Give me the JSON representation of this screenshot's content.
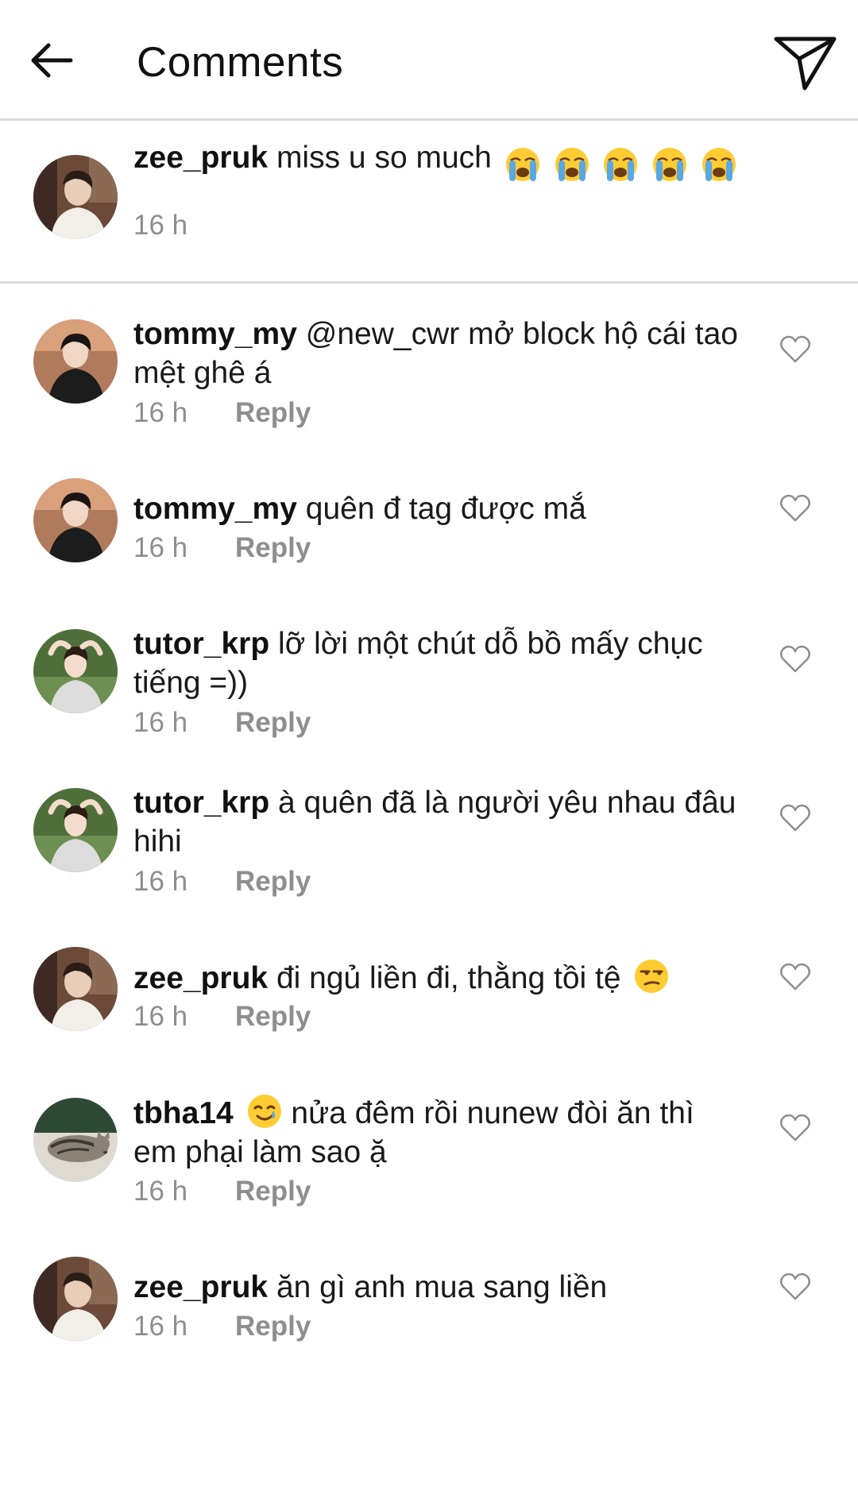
{
  "header": {
    "title": "Comments"
  },
  "caption": {
    "username": "zee_pruk",
    "text": "miss u so much",
    "emoji_count": 5,
    "emoji": "loudly-crying-face",
    "time": "16 h"
  },
  "reply_label": "Reply",
  "comments": [
    {
      "username": "tommy_my",
      "text": "@new_cwr mở block hộ cái tao mệt ghê á",
      "time": "16 h"
    },
    {
      "username": "tommy_my",
      "text": "quên đ tag được mắ",
      "time": "16 h"
    },
    {
      "username": "tutor_krp",
      "text": "lỡ lời một chút dỗ bồ mấy chục tiếng =))",
      "time": "16 h"
    },
    {
      "username": "tutor_krp",
      "text": "à quên đã là người yêu nhau đâu hihi",
      "time": "16 h"
    },
    {
      "username": "zee_pruk",
      "text": "đi ngủ liền đi, thằng tồi tệ",
      "emoji_after": "unamused-face",
      "time": "16 h"
    },
    {
      "username": "tbha14",
      "emoji_before": "smiling-face-with-tear",
      "text": "nửa đêm rồi nunew đòi ăn thì em phại làm sao ặ",
      "time": "16 h"
    },
    {
      "username": "zee_pruk",
      "text": "ăn gì anh mua sang liền",
      "time": "16 h"
    }
  ],
  "colors": {
    "text": "#111111",
    "secondary": "#8e8e8e",
    "divider": "#dcdcdc",
    "emoji_yellow": "#ffcc33",
    "tear_blue": "#5aa7e6"
  }
}
